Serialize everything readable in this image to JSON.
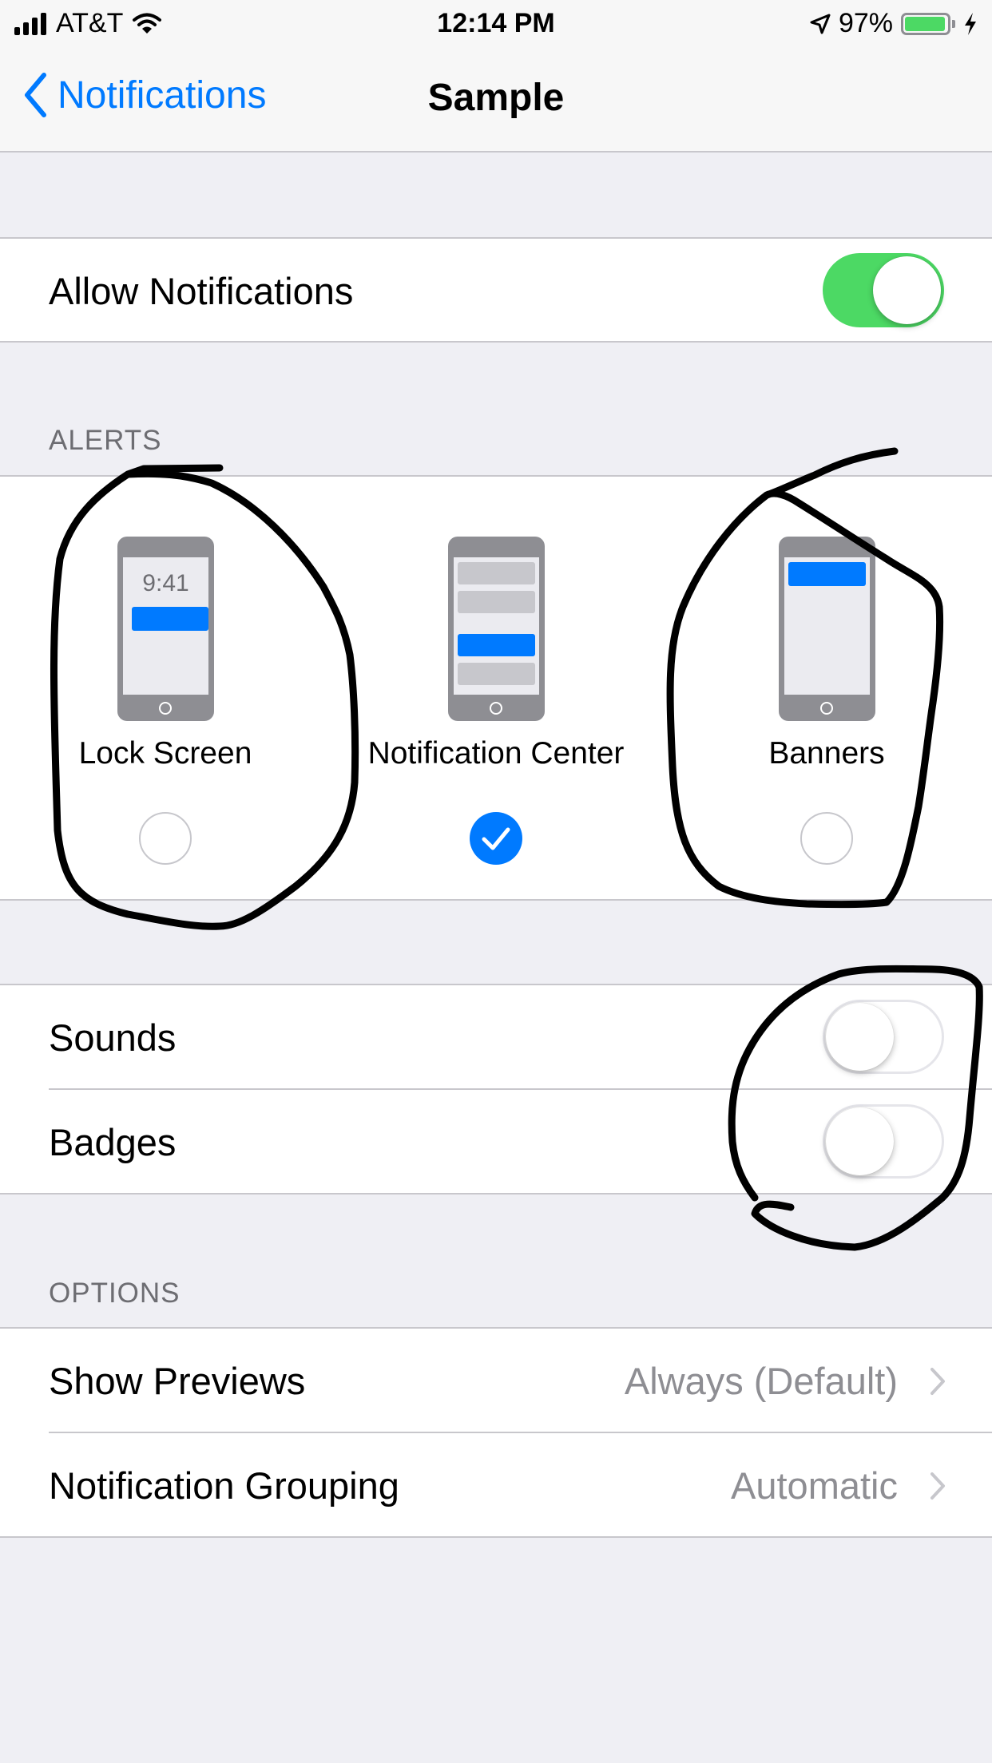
{
  "status_bar": {
    "carrier": "AT&T",
    "time": "12:14 PM",
    "battery_percent": "97%",
    "battery_level": 0.97
  },
  "nav": {
    "back_label": "Notifications",
    "title": "Sample"
  },
  "allow_notifications": {
    "label": "Allow Notifications",
    "enabled": true
  },
  "alerts": {
    "header": "ALERTS",
    "lock_screen_time": "9:41",
    "options": [
      {
        "label": "Lock Screen",
        "selected": false
      },
      {
        "label": "Notification Center",
        "selected": true
      },
      {
        "label": "Banners",
        "selected": false
      }
    ]
  },
  "toggles": [
    {
      "label": "Sounds",
      "enabled": false
    },
    {
      "label": "Badges",
      "enabled": false
    }
  ],
  "options": {
    "header": "OPTIONS",
    "rows": [
      {
        "label": "Show Previews",
        "value": "Always (Default)"
      },
      {
        "label": "Notification Grouping",
        "value": "Automatic"
      }
    ]
  },
  "colors": {
    "accent": "#007aff",
    "toggle_on": "#4cd964",
    "background": "#efeff4",
    "annotation_ink": "#000000"
  }
}
